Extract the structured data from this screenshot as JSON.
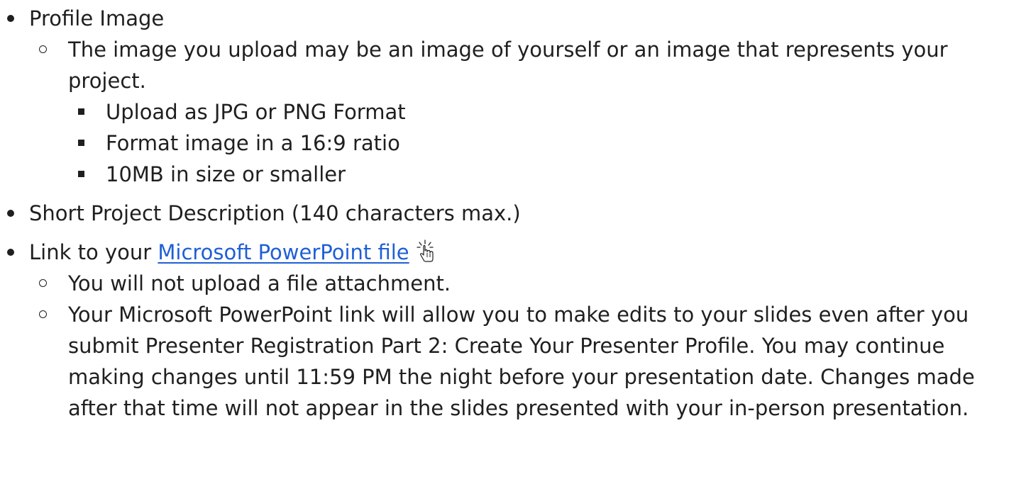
{
  "items": [
    {
      "label": "Profile Image",
      "sub": [
        {
          "label": "The image you upload may be an image of yourself or an image that represents your project.",
          "sub": [
            "Upload as JPG or PNG Format",
            "Format image in a 16:9 ratio",
            "10MB in size or smaller"
          ]
        }
      ]
    },
    {
      "label": "Short Project Description (140 characters max.)"
    },
    {
      "label_prefix": "Link to your ",
      "link_text": "Microsoft PowerPoint file",
      "cursor_icon": "hand-pointer-click-icon",
      "sub": [
        "You will not upload a file attachment.",
        "Your Microsoft PowerPoint link will allow you to make edits to your slides even after you submit Presenter Registration Part 2: Create Your Presenter Profile. You may continue making changes until 11:59 PM the night before your presentation date. Changes made after that time will not appear in the slides presented with your in-person presentation."
      ]
    }
  ],
  "colors": {
    "text": "#1f1f1f",
    "link": "#1f5fd6",
    "background": "#ffffff"
  }
}
